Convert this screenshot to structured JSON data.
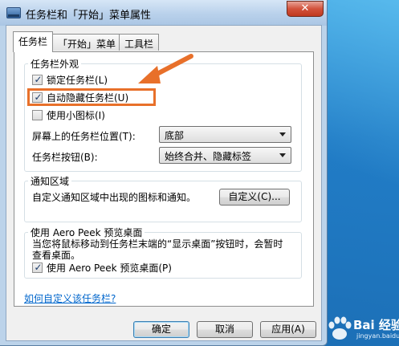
{
  "window": {
    "title": "任务栏和「开始」菜单属性",
    "close_label": "✕"
  },
  "tabs": [
    {
      "label": "任务栏",
      "active": true
    },
    {
      "label": "「开始」菜单",
      "active": false
    },
    {
      "label": "工具栏",
      "active": false
    }
  ],
  "appearance": {
    "group_title": "任务栏外观",
    "lock_taskbar": {
      "label": "锁定任务栏(L)",
      "checked": true
    },
    "auto_hide": {
      "label": "自动隐藏任务栏(U)",
      "checked": true
    },
    "small_icons": {
      "label": "使用小图标(I)",
      "checked": false
    },
    "position_label": "屏幕上的任务栏位置(T):",
    "position_value": "底部",
    "buttons_label": "任务栏按钮(B):",
    "buttons_value": "始终合并、隐藏标签"
  },
  "notification": {
    "group_title": "通知区域",
    "description": "自定义通知区域中出现的图标和通知。",
    "customize_button": "自定义(C)..."
  },
  "aero_peek": {
    "group_title": "使用 Aero Peek 预览桌面",
    "description_line1": "当您将鼠标移动到任务栏末端的“显示桌面”按钮时，会暂时",
    "description_line2": "查看桌面。",
    "checkbox": {
      "label": "使用 Aero Peek 预览桌面(P)",
      "checked": true
    }
  },
  "help_link": "如何自定义该任务栏?",
  "footer": {
    "ok_label": "确定",
    "cancel_label": "取消",
    "apply_label": "应用(A)"
  },
  "watermark": {
    "text": "Bai  经验",
    "subtext": "jingyan.baidu.com"
  },
  "colors": {
    "annotation": "#e8702a",
    "link": "#0066cc",
    "desktop": "#1f78c3"
  }
}
